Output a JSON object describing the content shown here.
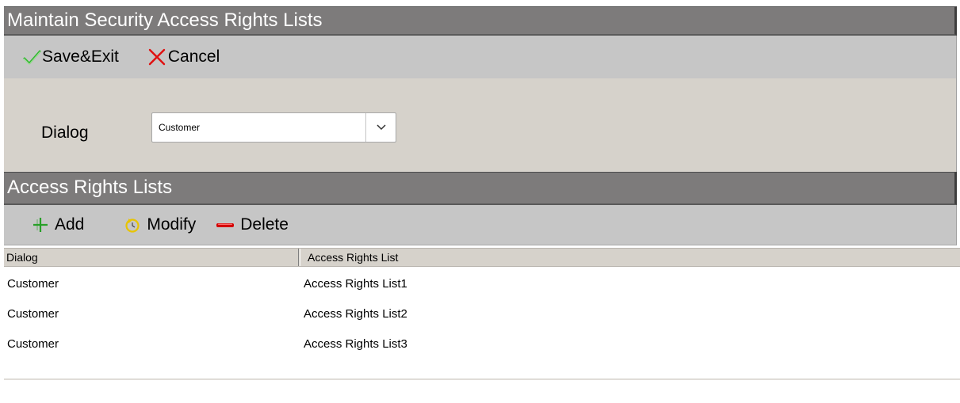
{
  "window": {
    "title": "Maintain Security Access Rights Lists"
  },
  "toolbar": {
    "save_label": "Save&Exit",
    "cancel_label": "Cancel"
  },
  "form": {
    "dialog_label": "Dialog",
    "dialog_value": "Customer"
  },
  "section": {
    "title": "Access Rights Lists"
  },
  "list_toolbar": {
    "add_label": "Add",
    "modify_label": "Modify",
    "delete_label": "Delete"
  },
  "grid": {
    "columns": [
      "Dialog",
      "Access Rights List"
    ],
    "rows": [
      {
        "dialog": "Customer",
        "list": "Access Rights List1"
      },
      {
        "dialog": "Customer",
        "list": "Access Rights List2"
      },
      {
        "dialog": "Customer",
        "list": "Access Rights List3"
      }
    ]
  },
  "colors": {
    "header_bg": "#7d7b7b",
    "toolbar_bg": "#c6c6c6",
    "panel_bg": "#d6d2cb",
    "save_icon": "#2fb52f",
    "cancel_icon": "#e01010",
    "add_icon": "#28a028",
    "modify_icon": "#e8c400",
    "delete_icon": "#d40000"
  },
  "icons": [
    "checkmark-icon",
    "x-cross-icon",
    "chevron-down-icon",
    "plus-icon",
    "refresh-icon",
    "minus-icon"
  ]
}
